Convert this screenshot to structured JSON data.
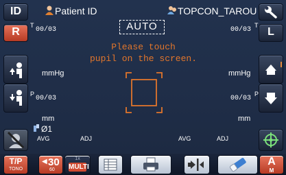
{
  "header": {
    "patient_id_label": "Patient ID",
    "operator_name": "TOPCON_TAROU",
    "mode_label": "AUTO"
  },
  "instruction": {
    "line1": "Please touch",
    "line2": "pupil on the screen."
  },
  "left_panel": {
    "top_marker": "T",
    "top_value": "00/03",
    "unit_mmhg": "mmHg",
    "p_marker": "P",
    "p_value": "00/03",
    "unit_mm": "mm",
    "diameter": "Ø1",
    "avg": "AVG",
    "adj": "ADJ"
  },
  "right_panel": {
    "top_marker": "T",
    "top_value": "00/03",
    "unit_mmhg": "mmHg",
    "p_marker": "P",
    "p_value": "00/03",
    "unit_mm": "mm",
    "avg": "AVG",
    "adj": "ADJ"
  },
  "left_toolbar": {
    "id_label": "ID",
    "r_label": "R"
  },
  "right_toolbar": {
    "l_label": "L"
  },
  "bottom_toolbar": {
    "tp_label": "T/P",
    "tono_label": "TONO",
    "count_label": "30",
    "count_sub": "60",
    "multi_top": "1x",
    "multi_label": "MULTI",
    "a_label": "A",
    "m_label": "M"
  },
  "colors": {
    "background": "#1f2d47",
    "accent_red": "#d9533f",
    "instruction_orange": "#e2762b",
    "text": "#ffffff"
  },
  "icons": [
    "person-icon",
    "wrench-icon",
    "patient-up-icon",
    "patient-down-icon",
    "chin-rest-up-icon",
    "chin-rest-down-icon",
    "reticle-icon",
    "no-stimulus-icon",
    "list-icon",
    "print-icon",
    "exit-icon",
    "eraser-icon"
  ]
}
